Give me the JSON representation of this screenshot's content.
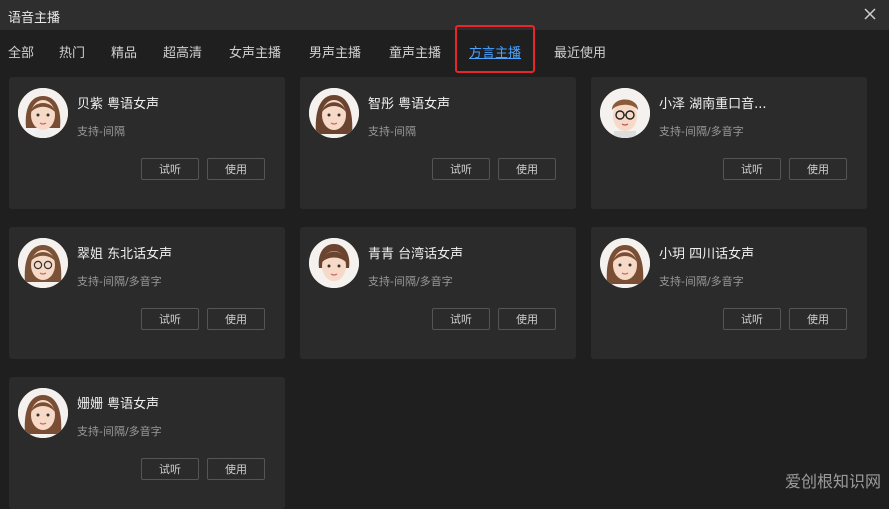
{
  "window": {
    "title": "语音主播"
  },
  "tabs": [
    {
      "label": "全部"
    },
    {
      "label": "热门"
    },
    {
      "label": "精品"
    },
    {
      "label": "超高清"
    },
    {
      "label": "女声主播"
    },
    {
      "label": "男声主播"
    },
    {
      "label": "童声主播"
    },
    {
      "label": "方言主播",
      "active": true
    },
    {
      "label": "最近使用"
    }
  ],
  "cards": [
    {
      "name": "贝紫 粤语女声",
      "desc": "支持-间隔",
      "listen": "试听",
      "use": "使用",
      "avatar": "female-avatar-icon"
    },
    {
      "name": "智彤 粤语女声",
      "desc": "支持-间隔",
      "listen": "试听",
      "use": "使用",
      "avatar": "female-avatar-icon"
    },
    {
      "name": "小泽 湖南重口音...",
      "desc": "支持-间隔/多音字",
      "listen": "试听",
      "use": "使用",
      "avatar": "male-glasses-avatar-icon"
    },
    {
      "name": "翠姐 东北话女声",
      "desc": "支持-间隔/多音字",
      "listen": "试听",
      "use": "使用",
      "avatar": "female-glasses-avatar-icon"
    },
    {
      "name": "青青 台湾话女声",
      "desc": "支持-间隔/多音字",
      "listen": "试听",
      "use": "使用",
      "avatar": "female-avatar-icon"
    },
    {
      "name": "小玥 四川话女声",
      "desc": "支持-间隔/多音字",
      "listen": "试听",
      "use": "使用",
      "avatar": "female-avatar-icon"
    },
    {
      "name": "姗姗 粤语女声",
      "desc": "支持-间隔/多音字",
      "listen": "试听",
      "use": "使用",
      "avatar": "female-avatar-icon"
    }
  ],
  "watermark": "爱创根知识网",
  "colors": {
    "accent": "#4aa3ff",
    "highlight_border": "#e8262a"
  }
}
